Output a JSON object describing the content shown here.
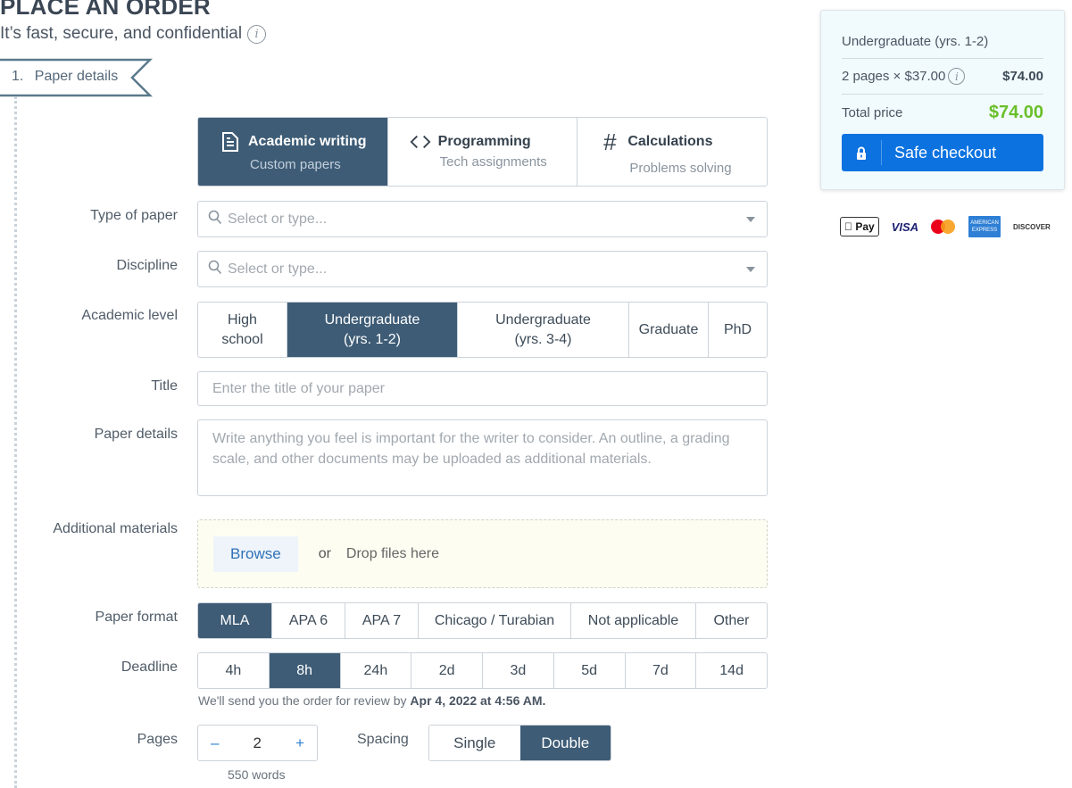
{
  "header": {
    "title": "PLACE AN ORDER",
    "subtitle": "It’s fast, secure, and confidential",
    "info_icon": "i"
  },
  "step": {
    "number": "1.",
    "label": "Paper details"
  },
  "categories": [
    {
      "title": "Academic writing",
      "subtitle": "Custom papers",
      "icon": "document-icon",
      "active": true
    },
    {
      "title": "Programming",
      "subtitle": "Tech assignments",
      "icon": "code-icon",
      "glyph": "‹›",
      "active": false
    },
    {
      "title": "Calculations",
      "subtitle": "Problems solving",
      "icon": "hash-icon",
      "glyph": "#",
      "active": false
    }
  ],
  "fields": {
    "type_of_paper": {
      "label": "Type of paper",
      "placeholder": "Select or type..."
    },
    "discipline": {
      "label": "Discipline",
      "placeholder": "Select or type..."
    },
    "academic_level": {
      "label": "Academic level",
      "options": [
        {
          "line1": "High",
          "line2": "school"
        },
        {
          "line1": "Undergraduate",
          "line2": "(yrs. 1-2)"
        },
        {
          "line1": "Undergraduate",
          "line2": "(yrs. 3-4)"
        },
        {
          "line1": "Graduate",
          "line2": ""
        },
        {
          "line1": "PhD",
          "line2": ""
        }
      ],
      "selected": "Undergraduate (yrs. 1-2)"
    },
    "title": {
      "label": "Title",
      "placeholder": "Enter the title of your paper"
    },
    "paper_details": {
      "label": "Paper details",
      "placeholder": "Write anything you feel is important for the writer to consider. An outline, a grading scale, and other documents may be uploaded as additional materials."
    },
    "additional_materials": {
      "label": "Additional materials",
      "browse": "Browse",
      "or": "or",
      "drop": "Drop files here"
    },
    "paper_format": {
      "label": "Paper format",
      "options": [
        "MLA",
        "APA 6",
        "APA 7",
        "Chicago / Turabian",
        "Not applicable",
        "Other"
      ],
      "selected": "MLA"
    },
    "deadline": {
      "label": "Deadline",
      "options": [
        "4h",
        "8h",
        "24h",
        "2d",
        "3d",
        "5d",
        "7d",
        "14d"
      ],
      "selected": "8h",
      "note_prefix": "We'll send you the order for review by",
      "note_date": "Apr 4, 2022 at 4:56 AM."
    },
    "pages": {
      "label": "Pages",
      "minus": "–",
      "value": "2",
      "plus": "+",
      "words": "550 words"
    },
    "spacing": {
      "label": "Spacing",
      "options": [
        "Single",
        "Double"
      ],
      "selected": "Double"
    }
  },
  "summary": {
    "level": "Undergraduate (yrs. 1-2)",
    "pages_line": "2 pages × $37.00",
    "pages_price": "$74.00",
    "total_label": "Total price",
    "total_value": "$74.00",
    "checkout_label": "Safe checkout",
    "total_color": "#6abf2a",
    "checkout_color": "#0b72e0"
  },
  "payment_methods": [
    {
      "name": "Apple Pay",
      "label": " Pay"
    },
    {
      "name": "Visa",
      "label": "VISA"
    },
    {
      "name": "Mastercard",
      "label": ""
    },
    {
      "name": "American Express",
      "label": "AMERICAN EXPRESS"
    },
    {
      "name": "Discover",
      "label": "DISCOVER"
    }
  ],
  "colors": {
    "active": "#3e5c76",
    "accent": "#0b72e0"
  }
}
